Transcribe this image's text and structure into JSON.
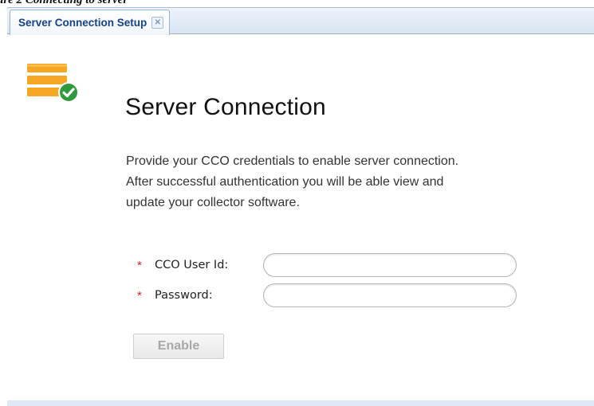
{
  "document": {
    "caption": "ure 2        Connecting to server"
  },
  "tab": {
    "label": "Server Connection Setup",
    "close_glyph": "✕"
  },
  "page": {
    "title": "Server Connection",
    "description_lines": [
      "Provide your CCO credentials to enable server connection.",
      "After successful authentication you will be able view and",
      "update your collector software."
    ]
  },
  "form": {
    "required_marker": "*",
    "user_id": {
      "label": "CCO User Id:",
      "value": "",
      "placeholder": ""
    },
    "password": {
      "label": "Password:",
      "value": "",
      "placeholder": ""
    },
    "enable_label": "Enable",
    "enable_disabled": true
  },
  "icons": {
    "server": "server-stack-icon",
    "check": "check-badge-icon",
    "close": "close-icon"
  },
  "colors": {
    "tab_text": "#15428b",
    "server_orange": "#f5a623",
    "check_green": "#2e9a3c",
    "required": "#cc2222",
    "disabled_text": "#a8a8a8"
  }
}
